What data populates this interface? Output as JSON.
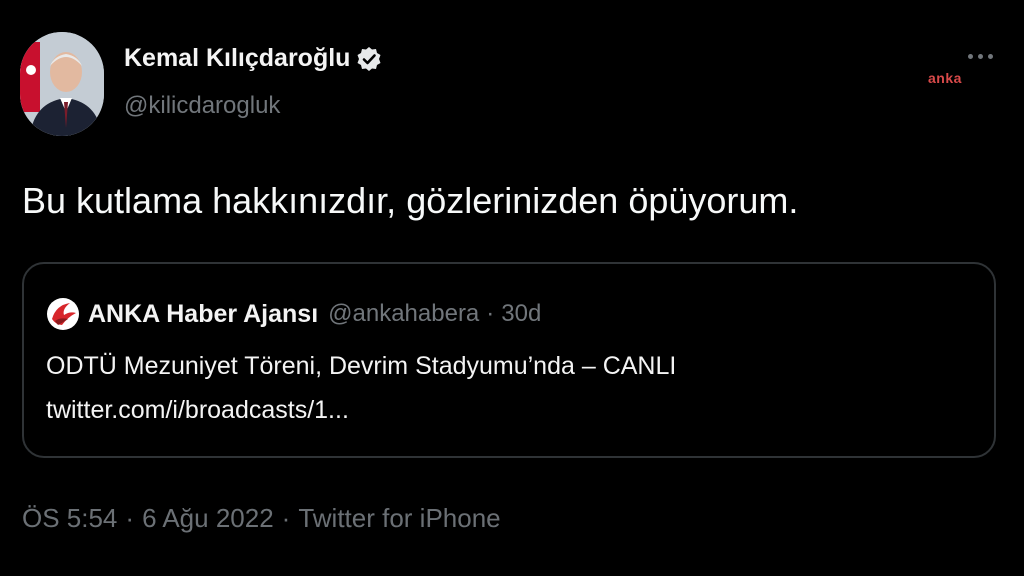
{
  "author": {
    "name": "Kemal Kılıçdaroğlu",
    "handle": "@kilicdarogluk",
    "avatar_icon": "user-avatar-icon",
    "verified_icon": "verified-badge-icon"
  },
  "header": {
    "more_icon": "more-horizontal-icon",
    "watermark": "anka"
  },
  "tweet": {
    "text": "Bu kutlama hakkınızdır, gözlerinizden öpüyorum."
  },
  "quote": {
    "logo_icon": "anka-logo-icon",
    "name": "ANKA Haber Ajansı",
    "handle": "@ankahabera",
    "separator": "·",
    "time": "30d",
    "line1": "ODTÜ Mezuniyet Töreni, Devrim Stadyumu’nda – CANLI",
    "link": "twitter.com/i/broadcasts/1..."
  },
  "footer": {
    "time": "ÖS 5:54",
    "separator": "·",
    "date": "6 Ağu 2022",
    "source": "Twitter for iPhone"
  },
  "colors": {
    "background": "#000000",
    "text": "#f4f4f4",
    "secondary": "#71767b",
    "border": "#2f3336",
    "watermark": "#d94a4a"
  }
}
